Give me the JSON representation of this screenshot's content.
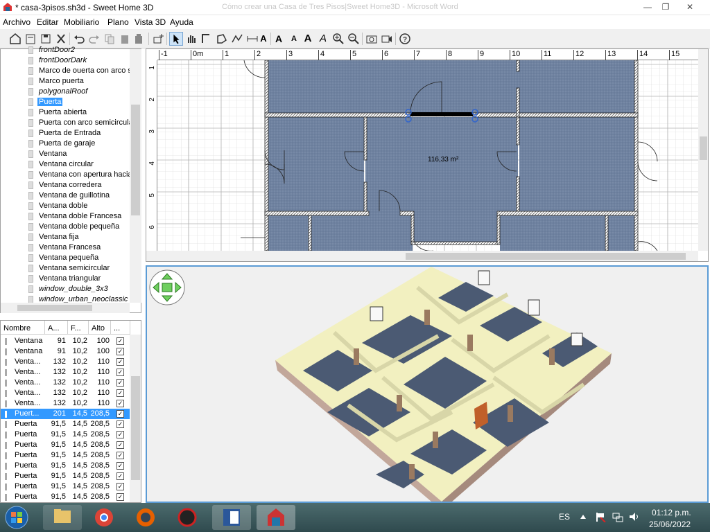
{
  "window": {
    "title": "* casa-3pisos.sh3d - Sweet Home 3D",
    "ghost_title": "Cómo crear una Casa de Tres Pisos|Sweet Home3D - Microsoft Word",
    "minimize": "—",
    "maximize": "❐",
    "close": "✕"
  },
  "menu": [
    "Archivo",
    "Editar",
    "Mobiliario",
    "Plano",
    "Vista 3D",
    "Ayuda"
  ],
  "toolbar": {
    "add_text": "A",
    "font_bigger": "A",
    "font_smaller": "A",
    "bold": "A",
    "italic": "A",
    "help": "?"
  },
  "catalog": {
    "items": [
      {
        "label": "frontDoor2",
        "italic": true
      },
      {
        "label": "frontDoorDark",
        "italic": true
      },
      {
        "label": "Marco de ouerta con arco s",
        "italic": false
      },
      {
        "label": "Marco puerta",
        "italic": false
      },
      {
        "label": "polygonalRoof",
        "italic": true
      },
      {
        "label": "Puerta",
        "italic": false,
        "selected": true
      },
      {
        "label": "Puerta abierta",
        "italic": false
      },
      {
        "label": "Puerta con arco semicircula",
        "italic": false
      },
      {
        "label": "Puerta de Entrada",
        "italic": false
      },
      {
        "label": "Puerta de garaje",
        "italic": false
      },
      {
        "label": "Ventana",
        "italic": false
      },
      {
        "label": "Ventana circular",
        "italic": false
      },
      {
        "label": "Ventana con apertura hacia",
        "italic": false
      },
      {
        "label": "Ventana corredera",
        "italic": false
      },
      {
        "label": "Ventana de guillotina",
        "italic": false
      },
      {
        "label": "Ventana doble",
        "italic": false
      },
      {
        "label": "Ventana doble Francesa",
        "italic": false
      },
      {
        "label": "Ventana doble pequeña",
        "italic": false
      },
      {
        "label": "Ventana fija",
        "italic": false
      },
      {
        "label": "Ventana Francesa",
        "italic": false
      },
      {
        "label": "Ventana pequeña",
        "italic": false
      },
      {
        "label": "Ventana semicircular",
        "italic": false
      },
      {
        "label": "Ventana triangular",
        "italic": false
      },
      {
        "label": "window_double_3x3",
        "italic": true
      },
      {
        "label": "window_urban_neoclassic",
        "italic": true
      }
    ]
  },
  "furniture": {
    "columns": [
      "Nombre",
      "A...",
      "F...",
      "Alto",
      "..."
    ],
    "rows": [
      {
        "name": "Ventana",
        "w": "91",
        "d": "10,2",
        "h": "100"
      },
      {
        "name": "Ventana",
        "w": "91",
        "d": "10,2",
        "h": "100"
      },
      {
        "name": "Venta...",
        "w": "132",
        "d": "10,2",
        "h": "110"
      },
      {
        "name": "Venta...",
        "w": "132",
        "d": "10,2",
        "h": "110"
      },
      {
        "name": "Venta...",
        "w": "132",
        "d": "10,2",
        "h": "110"
      },
      {
        "name": "Venta...",
        "w": "132",
        "d": "10,2",
        "h": "110"
      },
      {
        "name": "Venta...",
        "w": "132",
        "d": "10,2",
        "h": "110"
      },
      {
        "name": "Puert...",
        "w": "201",
        "d": "14,5",
        "h": "208,5",
        "selected": true
      },
      {
        "name": "Puerta",
        "w": "91,5",
        "d": "14,5",
        "h": "208,5"
      },
      {
        "name": "Puerta",
        "w": "91,5",
        "d": "14,5",
        "h": "208,5"
      },
      {
        "name": "Puerta",
        "w": "91,5",
        "d": "14,5",
        "h": "208,5"
      },
      {
        "name": "Puerta",
        "w": "91,5",
        "d": "14,5",
        "h": "208,5"
      },
      {
        "name": "Puerta",
        "w": "91,5",
        "d": "14,5",
        "h": "208,5"
      },
      {
        "name": "Puerta",
        "w": "91,5",
        "d": "14,5",
        "h": "208,5"
      },
      {
        "name": "Puerta",
        "w": "91,5",
        "d": "14,5",
        "h": "208,5"
      },
      {
        "name": "Puerta",
        "w": "91,5",
        "d": "14,5",
        "h": "208,5"
      }
    ],
    "checkmark": "✓"
  },
  "plan": {
    "ruler_x": [
      "-1",
      "0m",
      "1",
      "2",
      "3",
      "4",
      "5",
      "6",
      "7",
      "8",
      "9",
      "10",
      "11",
      "12",
      "13",
      "14",
      "15"
    ],
    "ruler_y": [
      "1",
      "2",
      "3",
      "4",
      "5",
      "6"
    ],
    "area_label": "116,33 m²"
  },
  "taskbar": {
    "language": "ES",
    "time": "01:12 p.m.",
    "date": "25/06/2022"
  },
  "colors": {
    "selection": "#3399ff",
    "floor": "#6b7f99",
    "wall_3d": "#f2f0c0",
    "view_border": "#5a9bd5"
  }
}
